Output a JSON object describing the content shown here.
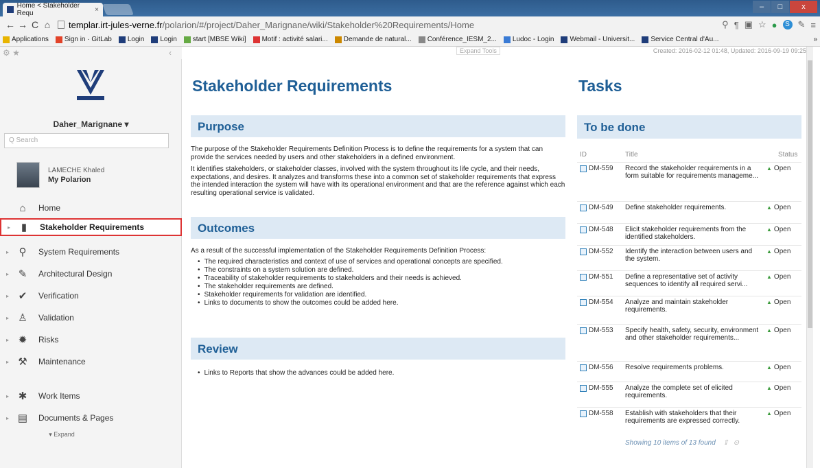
{
  "browser": {
    "tab_title": "Home < Stakeholder Requ",
    "tab_close": "×",
    "url_host": "templar.irt-jules-verne.fr",
    "url_path": "/polarion/#/project/Daher_Marignane/wiki/Stakeholder%20Requirements/Home",
    "nav": {
      "back": "←",
      "forward": "→",
      "reload": "C",
      "home": "⌂"
    },
    "window": {
      "minimize": "–",
      "maximize": "□",
      "close": "x"
    },
    "bookmarks": [
      {
        "label": "Applications",
        "color": "#e8b400"
      },
      {
        "label": "Sign in · GitLab",
        "color": "#e24329"
      },
      {
        "label": "Login",
        "color": "#1f3d7a"
      },
      {
        "label": "Login",
        "color": "#1f3d7a"
      },
      {
        "label": "start [MBSE Wiki]",
        "color": "#6a4"
      },
      {
        "label": "Motif : activité salari...",
        "color": "#d33"
      },
      {
        "label": "Demande de natural...",
        "color": "#c80"
      },
      {
        "label": "Conférence_IESM_2...",
        "color": "#888"
      },
      {
        "label": "Ludoc - Login",
        "color": "#3a7bd5"
      },
      {
        "label": "Webmail - Universit...",
        "color": "#1f3d7a"
      },
      {
        "label": "Service Central d'Au...",
        "color": "#1f3d7a"
      }
    ]
  },
  "sidebar": {
    "project": "Daher_Marignane ▾",
    "search_placeholder": "Q Search",
    "user_name": "LAMECHE Khaled",
    "user_link": "My Polarion",
    "expand": "▾ Expand",
    "items": [
      {
        "label": "Home",
        "icon": "home-icon",
        "glyph": "⌂"
      },
      {
        "label": "Stakeholder Requirements",
        "icon": "document-icon",
        "glyph": "▮",
        "active": true
      },
      {
        "label": "System Requirements",
        "icon": "magnifier-icon",
        "glyph": "⚲"
      },
      {
        "label": "Architectural Design",
        "icon": "pencil-icon",
        "glyph": "✎"
      },
      {
        "label": "Verification",
        "icon": "checkmark-icon",
        "glyph": "✔"
      },
      {
        "label": "Validation",
        "icon": "podium-icon",
        "glyph": "♙"
      },
      {
        "label": "Risks",
        "icon": "risk-icon",
        "glyph": "✹"
      },
      {
        "label": "Maintenance",
        "icon": "wrench-icon",
        "glyph": "⚒"
      },
      {
        "label": "Work Items",
        "icon": "work-items-icon",
        "glyph": "✱"
      },
      {
        "label": "Documents & Pages",
        "icon": "pages-icon",
        "glyph": "▤"
      }
    ]
  },
  "main": {
    "expand_tools": "Expand Tools",
    "created": "Created: 2016-02-12 01:48, Updated: 2016-09-19 09:25",
    "title": "Stakeholder Requirements",
    "purpose": {
      "heading": "Purpose",
      "p1": "The purpose of the Stakeholder Requirements Definition Process is to define the requirements for a system that can provide the services needed by users and other stakeholders in a defined environment.",
      "p2": "It identifies stakeholders, or stakeholder classes, involved with the system throughout its life cycle, and their needs, expectations, and desires. It analyzes and transforms these into a common set of stakeholder requirements that express the intended interaction the system will have with its operational environment and that are the reference against which each resulting operational service is validated."
    },
    "outcomes": {
      "heading": "Outcomes",
      "intro": "As a result of the successful implementation of the Stakeholder Requirements Definition Process:",
      "items": [
        "The required characteristics and context of use of services and operational concepts are specified.",
        "The constraints on a system solution are defined.",
        "Traceability of stakeholder requirements to stakeholders and their needs is achieved.",
        "The stakeholder requirements are defined.",
        "Stakeholder requirements for validation are identified.",
        "Links to documents to show the outcomes could be added here."
      ]
    },
    "review": {
      "heading": "Review",
      "items": [
        "Links to Reports that show the advances could be added here."
      ]
    }
  },
  "tasks": {
    "title": "Tasks",
    "subtitle": "To be done",
    "columns": {
      "id": "ID",
      "title": "Title",
      "status": "Status"
    },
    "rows": [
      {
        "id": "DM-559",
        "title": "Record the stakeholder requirements in a form suitable for requirements manageme...",
        "status": "Open"
      },
      {
        "id": "DM-549",
        "title": "Define stakeholder requirements.",
        "status": "Open"
      },
      {
        "id": "DM-548",
        "title": "Elicit stakeholder requirements from the identified stakeholders.",
        "status": "Open"
      },
      {
        "id": "DM-552",
        "title": "Identify the interaction between users and the system.",
        "status": "Open"
      },
      {
        "id": "DM-551",
        "title": "Define a representative set of activity sequences to identify all required servi...",
        "status": "Open"
      },
      {
        "id": "DM-554",
        "title": "Analyze and maintain stakeholder requirements.",
        "status": "Open"
      },
      {
        "id": "DM-553",
        "title": "Specify health, safety, security, environment and other stakeholder requirements...",
        "status": "Open"
      },
      {
        "id": "DM-556",
        "title": "Resolve requirements problems.",
        "status": "Open"
      },
      {
        "id": "DM-555",
        "title": "Analyze the complete set of elicited requirements.",
        "status": "Open"
      },
      {
        "id": "DM-558",
        "title": "Establish with stakeholders that their requirements are expressed correctly.",
        "status": "Open"
      }
    ],
    "footer": "Showing 10 items of 13 found"
  }
}
